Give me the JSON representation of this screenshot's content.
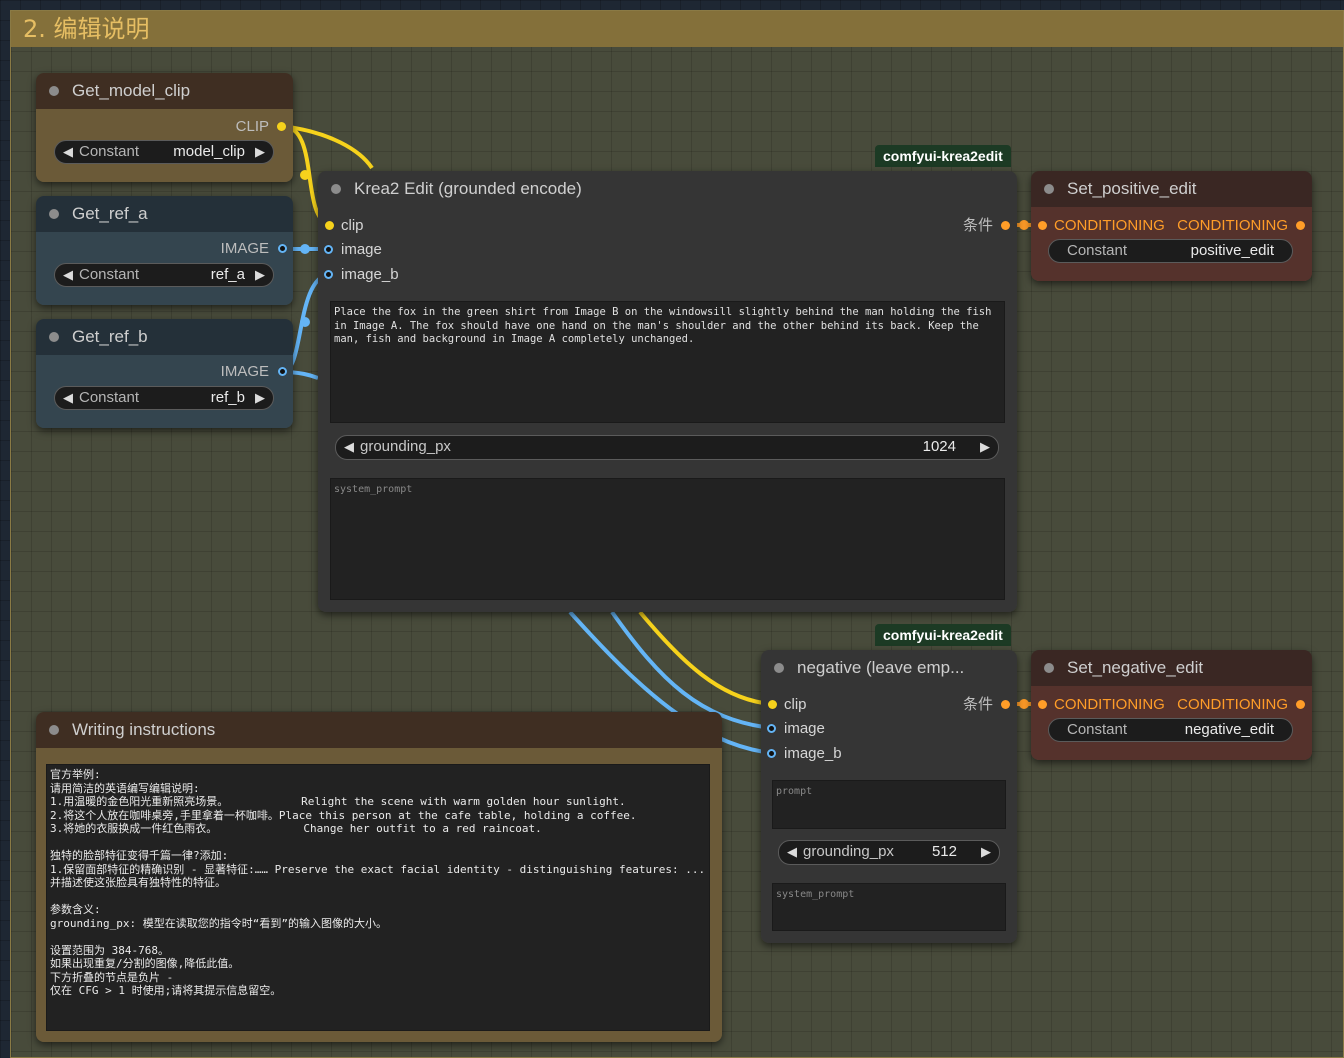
{
  "group": {
    "title": "2. 编辑说明"
  },
  "nodes": {
    "get_model_clip": {
      "title": "Get_model_clip",
      "output": "CLIP",
      "widget": {
        "name": "Constant",
        "value": "model_clip"
      }
    },
    "get_ref_a": {
      "title": "Get_ref_a",
      "output": "IMAGE",
      "widget": {
        "name": "Constant",
        "value": "ref_a"
      }
    },
    "get_ref_b": {
      "title": "Get_ref_b",
      "output": "IMAGE",
      "widget": {
        "name": "Constant",
        "value": "ref_b"
      }
    },
    "krea_edit": {
      "badge": "comfyui-krea2edit",
      "title": "Krea2 Edit (grounded encode)",
      "inputs": [
        "clip",
        "image",
        "image_b"
      ],
      "output": "条件",
      "prompt": "Place the fox in the green shirt from Image B on the windowsill slightly behind the man holding the fish in Image A. The fox should have one hand on the man's shoulder and the other behind its back. Keep the man, fish and background in Image A completely unchanged.",
      "grounding": {
        "name": "grounding_px",
        "value": "1024"
      },
      "system_prompt_placeholder": "system_prompt"
    },
    "set_positive": {
      "title": "Set_positive_edit",
      "input": "CONDITIONING",
      "output": "CONDITIONING",
      "widget": {
        "name": "Constant",
        "value": "positive_edit"
      }
    },
    "negative": {
      "badge": "comfyui-krea2edit",
      "title": "negative (leave emp...",
      "inputs": [
        "clip",
        "image",
        "image_b"
      ],
      "output": "条件",
      "prompt_placeholder": "prompt",
      "grounding": {
        "name": "grounding_px",
        "value": "512"
      },
      "system_prompt_placeholder": "system_prompt"
    },
    "set_negative": {
      "title": "Set_negative_edit",
      "input": "CONDITIONING",
      "output": "CONDITIONING",
      "widget": {
        "name": "Constant",
        "value": "negative_edit"
      }
    },
    "writing": {
      "title": "Writing instructions",
      "text": "官方举例:\n请用简洁的英语编写编辑说明:\n1.用温暖的金色阳光重新照亮场景。           Relight the scene with warm golden hour sunlight.\n2.将这个人放在咖啡桌旁,手里拿着一杯咖啡。Place this person at the cafe table, holding a coffee.\n3.将她的衣服换成一件红色雨衣。             Change her outfit to a red raincoat.\n\n独特的脸部特征变得千篇一律?添加:\n1.保留面部特征的精确识别 - 显著特征:…… Preserve the exact facial identity - distinguishing features: ...\n并描述使这张脸具有独特性的特征。\n\n参数含义:\ngrounding_px: 模型在读取您的指令时“看到”的输入图像的大小。\n\n设置范围为 384-768。\n如果出现重复/分割的图像,降低此值。\n下方折叠的节点是负片 -\n仅在 CFG > 1 时使用;请将其提示信息留空。"
    }
  },
  "colors": {
    "clip_wire": "#f6d21c",
    "image_wire": "#64b5f6",
    "conditioning_port": "#ff9d28",
    "group_header": "#84703a"
  }
}
